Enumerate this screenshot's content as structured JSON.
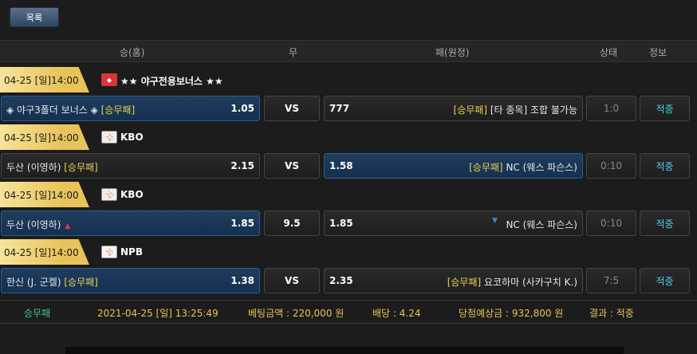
{
  "toolbar": {
    "list_label": "목록"
  },
  "columns": {
    "home": "승(홈)",
    "draw": "무",
    "away": "패(원정)",
    "status": "상태",
    "info": "정보"
  },
  "groups": [
    {
      "date": "04-25 [일]14:00",
      "league_icon": "bonus-badge-icon",
      "league": "★★ 야구전용보너스 ★★",
      "home_team": "◈ 야구3폴더 보너스 ◈",
      "home_tag": "[승무패]",
      "home_odds": "1.05",
      "draw": "VS",
      "away_odds": "777",
      "away_tag": "[승무패]",
      "away_team": "[타 종목] 조합 불가능",
      "status": "1:0",
      "info": "적중",
      "selected": "home"
    },
    {
      "date": "04-25 [일]14:00",
      "league_icon": "kbo-logo-icon",
      "league": "KBO",
      "home_team": "두산 (이영하)",
      "home_tag": "[승무패]",
      "home_odds": "2.15",
      "draw": "VS",
      "away_odds": "1.58",
      "away_tag": "[승무패]",
      "away_team": "NC (웨스 파슨스)",
      "status": "0:10",
      "info": "적중",
      "selected": "away"
    },
    {
      "date": "04-25 [일]14:00",
      "league_icon": "kbo-logo-icon",
      "league": "KBO",
      "home_team": "두산 (이영하)",
      "home_tag": "",
      "home_odds": "1.85",
      "draw": "9.5",
      "away_odds": "1.85",
      "away_tag": "",
      "away_team": "NC (웨스 파슨스)",
      "status": "0:10",
      "info": "적중",
      "selected": "home"
    },
    {
      "date": "04-25 [일]14:00",
      "league_icon": "npb-logo-icon",
      "league": "NPB",
      "home_team": "한신 (J. 군켈)",
      "home_tag": "[승무패]",
      "home_odds": "1.38",
      "draw": "VS",
      "away_odds": "2.35",
      "away_tag": "[승무패]",
      "away_team": "요코하마 (사카구치 K.)",
      "status": "7:5",
      "info": "적중",
      "selected": "home"
    }
  ],
  "summary": {
    "type": "승무패",
    "datetime": "2021-04-25 [일] 13:25:49",
    "bet_amount": "베팅금액 : 220,000 원",
    "odds": "배당 : 4.24",
    "expected": "당첨예상금 : 932,800 원",
    "result": "결과 : 적중"
  },
  "colors": {
    "accent": "#e8c35a",
    "active_cell": "#1f3d5e",
    "info": "#4fd1e6",
    "tag": "#e8d44d"
  }
}
